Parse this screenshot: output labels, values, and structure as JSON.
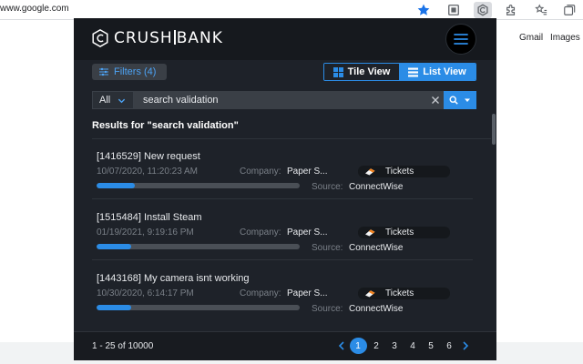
{
  "browser": {
    "url": "www.google.com",
    "links": [
      "Gmail",
      "Images"
    ]
  },
  "header": {
    "logo_left": "CRUSH",
    "logo_right": "BANK"
  },
  "toolbar": {
    "filters_label": "Filters (4)",
    "tile_view_label": "Tile View",
    "list_view_label": "List View",
    "active_view": "List View"
  },
  "search": {
    "scope": "All",
    "query": "search validation"
  },
  "results": {
    "heading": "Results for \"search validation\"",
    "company_label": "Company:",
    "source_label": "Source:",
    "items": [
      {
        "title": "[1416529] New request",
        "date": "10/07/2020, 11:20:23 AM",
        "company": "Paper S...",
        "tag": "Tickets",
        "source": "ConnectWise",
        "relevance": 0.19
      },
      {
        "title": "[1515484] Install Steam",
        "date": "01/19/2021, 9:19:16 PM",
        "company": "Paper S...",
        "tag": "Tickets",
        "source": "ConnectWise",
        "relevance": 0.17
      },
      {
        "title": "[1443168] My camera isnt working",
        "date": "10/30/2020, 6:14:17 PM",
        "company": "Paper S...",
        "tag": "Tickets",
        "source": "ConnectWise",
        "relevance": 0.17
      }
    ]
  },
  "footer": {
    "range": "1 - 25 of 10000",
    "pages": [
      "1",
      "2",
      "3",
      "4",
      "5",
      "6"
    ],
    "current_page": "1"
  },
  "colors": {
    "accent": "#2b8ce6",
    "panel": "#1e2229",
    "header": "#16191e"
  }
}
